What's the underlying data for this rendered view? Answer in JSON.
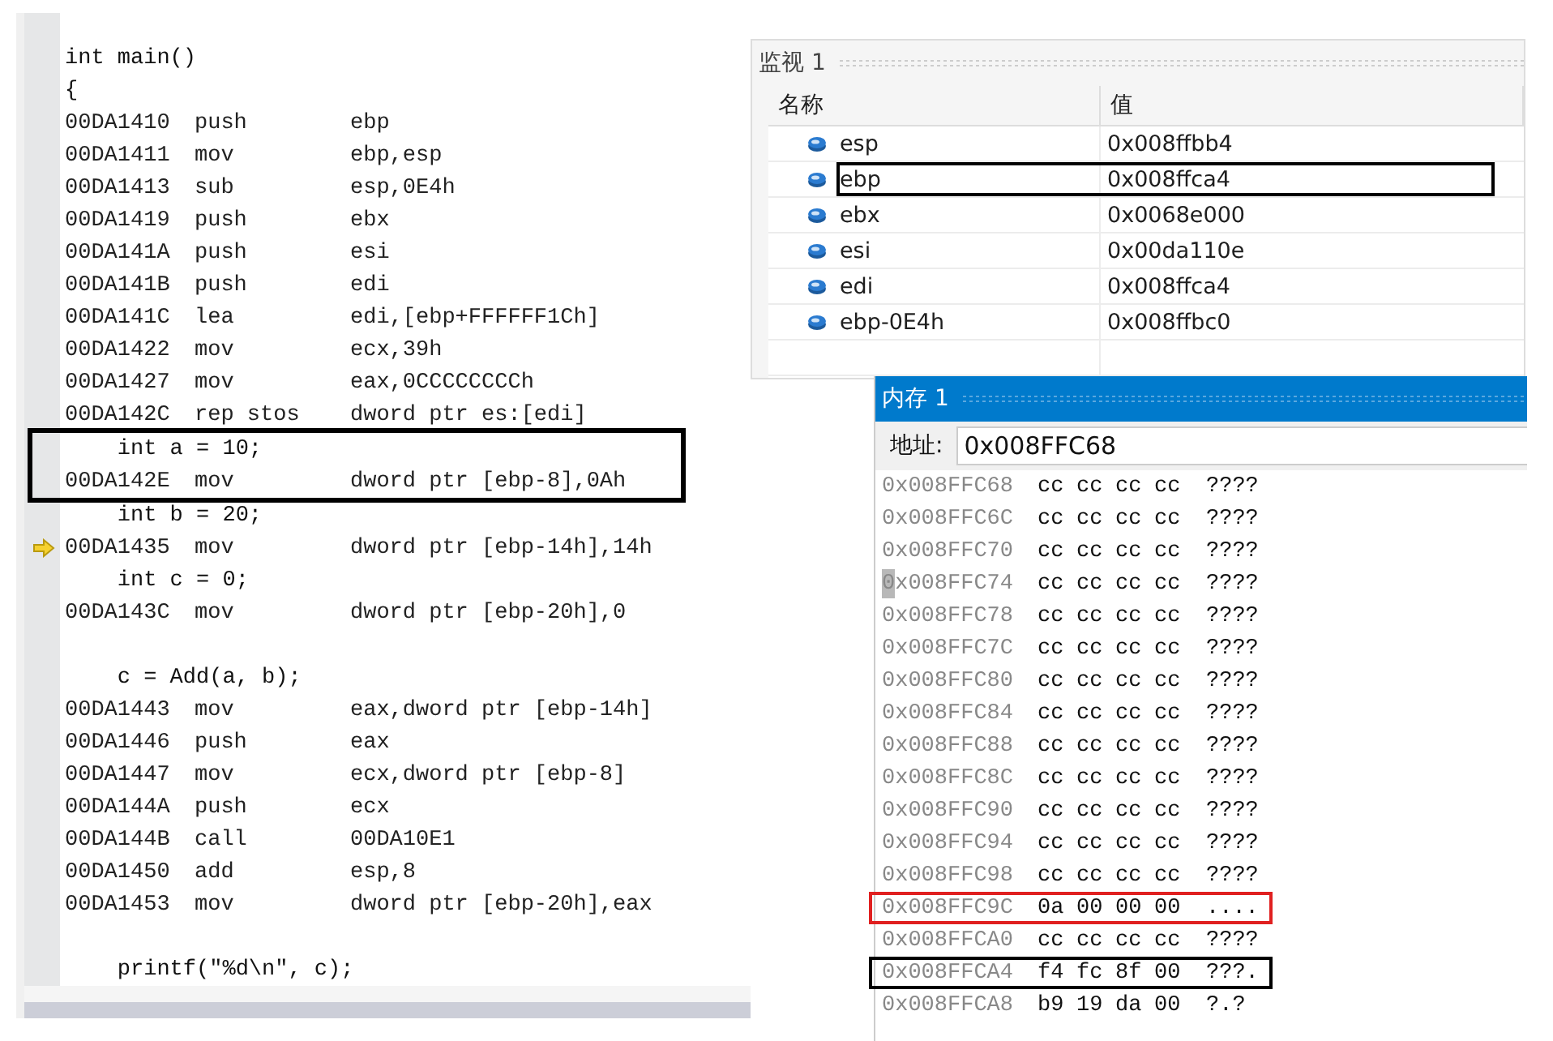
{
  "disassembly": {
    "lines": [
      {
        "kind": "source",
        "text": "int main()"
      },
      {
        "kind": "source",
        "text": "{"
      },
      {
        "kind": "asm",
        "address": "00DA1410",
        "mnemonic": "push",
        "operands": "ebp",
        "current": false
      },
      {
        "kind": "asm",
        "address": "00DA1411",
        "mnemonic": "mov",
        "operands": "ebp,esp",
        "current": false
      },
      {
        "kind": "asm",
        "address": "00DA1413",
        "mnemonic": "sub",
        "operands": "esp,0E4h",
        "current": false
      },
      {
        "kind": "asm",
        "address": "00DA1419",
        "mnemonic": "push",
        "operands": "ebx",
        "current": false
      },
      {
        "kind": "asm",
        "address": "00DA141A",
        "mnemonic": "push",
        "operands": "esi",
        "current": false
      },
      {
        "kind": "asm",
        "address": "00DA141B",
        "mnemonic": "push",
        "operands": "edi",
        "current": false
      },
      {
        "kind": "asm",
        "address": "00DA141C",
        "mnemonic": "lea",
        "operands": "edi,[ebp+FFFFFF1Ch]",
        "current": false
      },
      {
        "kind": "asm",
        "address": "00DA1422",
        "mnemonic": "mov",
        "operands": "ecx,39h",
        "current": false
      },
      {
        "kind": "asm",
        "address": "00DA1427",
        "mnemonic": "mov",
        "operands": "eax,0CCCCCCCCh",
        "current": false
      },
      {
        "kind": "asm",
        "address": "00DA142C",
        "mnemonic": "rep stos",
        "operands": "dword ptr es:[edi]",
        "current": false
      },
      {
        "kind": "outlined",
        "color": "#000000",
        "children": [
          {
            "kind": "source",
            "text": "    int a = 10;"
          },
          {
            "kind": "asm",
            "address": "00DA142E",
            "mnemonic": "mov",
            "operands": "dword ptr [ebp-8],0Ah",
            "current": false
          }
        ]
      },
      {
        "kind": "source",
        "text": "    int b = 20;"
      },
      {
        "kind": "asm",
        "address": "00DA1435",
        "mnemonic": "mov",
        "operands": "dword ptr [ebp-14h],14h",
        "current": true
      },
      {
        "kind": "source",
        "text": "    int c = 0;"
      },
      {
        "kind": "asm",
        "address": "00DA143C",
        "mnemonic": "mov",
        "operands": "dword ptr [ebp-20h],0",
        "current": false
      },
      {
        "kind": "blank"
      },
      {
        "kind": "source",
        "text": "    c = Add(a, b);"
      },
      {
        "kind": "asm",
        "address": "00DA1443",
        "mnemonic": "mov",
        "operands": "eax,dword ptr [ebp-14h]",
        "current": false
      },
      {
        "kind": "asm",
        "address": "00DA1446",
        "mnemonic": "push",
        "operands": "eax",
        "current": false
      },
      {
        "kind": "asm",
        "address": "00DA1447",
        "mnemonic": "mov",
        "operands": "ecx,dword ptr [ebp-8]",
        "current": false
      },
      {
        "kind": "asm",
        "address": "00DA144A",
        "mnemonic": "push",
        "operands": "ecx",
        "current": false
      },
      {
        "kind": "asm",
        "address": "00DA144B",
        "mnemonic": "call",
        "operands": "00DA10E1",
        "current": false
      },
      {
        "kind": "asm",
        "address": "00DA1450",
        "mnemonic": "add",
        "operands": "esp,8",
        "current": false
      },
      {
        "kind": "asm",
        "address": "00DA1453",
        "mnemonic": "mov",
        "operands": "dword ptr [ebp-20h],eax",
        "current": false
      },
      {
        "kind": "blank"
      },
      {
        "kind": "source",
        "text": "    printf(\"%d\\n\", c);"
      }
    ]
  },
  "watch": {
    "title": "监视 1",
    "columns": [
      "名称",
      "值"
    ],
    "rows": [
      {
        "name": "esp",
        "value": "0x008ffbb4",
        "outlined": false
      },
      {
        "name": "ebp",
        "value": "0x008ffca4",
        "outlined": true,
        "color": "#000000"
      },
      {
        "name": "ebx",
        "value": "0x0068e000",
        "outlined": false
      },
      {
        "name": "esi",
        "value": "0x00da110e",
        "outlined": false
      },
      {
        "name": "edi",
        "value": "0x008ffca4",
        "outlined": false
      },
      {
        "name": "ebp-0E4h",
        "value": "0x008ffbc0",
        "outlined": false
      }
    ]
  },
  "memory": {
    "title": "内存 1",
    "address_label": "地址:",
    "address_value": "0x008FFC68",
    "rows": [
      {
        "address": "0x008FFC68",
        "bytes": [
          "cc",
          "cc",
          "cc",
          "cc"
        ],
        "ascii": "????",
        "cursor": false,
        "outlined": false
      },
      {
        "address": "0x008FFC6C",
        "bytes": [
          "cc",
          "cc",
          "cc",
          "cc"
        ],
        "ascii": "????",
        "cursor": false,
        "outlined": false
      },
      {
        "address": "0x008FFC70",
        "bytes": [
          "cc",
          "cc",
          "cc",
          "cc"
        ],
        "ascii": "????",
        "cursor": false,
        "outlined": false
      },
      {
        "address": "0x008FFC74",
        "bytes": [
          "cc",
          "cc",
          "cc",
          "cc"
        ],
        "ascii": "????",
        "cursor": true,
        "outlined": false
      },
      {
        "address": "0x008FFC78",
        "bytes": [
          "cc",
          "cc",
          "cc",
          "cc"
        ],
        "ascii": "????",
        "cursor": false,
        "outlined": false
      },
      {
        "address": "0x008FFC7C",
        "bytes": [
          "cc",
          "cc",
          "cc",
          "cc"
        ],
        "ascii": "????",
        "cursor": false,
        "outlined": false
      },
      {
        "address": "0x008FFC80",
        "bytes": [
          "cc",
          "cc",
          "cc",
          "cc"
        ],
        "ascii": "????",
        "cursor": false,
        "outlined": false
      },
      {
        "address": "0x008FFC84",
        "bytes": [
          "cc",
          "cc",
          "cc",
          "cc"
        ],
        "ascii": "????",
        "cursor": false,
        "outlined": false
      },
      {
        "address": "0x008FFC88",
        "bytes": [
          "cc",
          "cc",
          "cc",
          "cc"
        ],
        "ascii": "????",
        "cursor": false,
        "outlined": false
      },
      {
        "address": "0x008FFC8C",
        "bytes": [
          "cc",
          "cc",
          "cc",
          "cc"
        ],
        "ascii": "????",
        "cursor": false,
        "outlined": false
      },
      {
        "address": "0x008FFC90",
        "bytes": [
          "cc",
          "cc",
          "cc",
          "cc"
        ],
        "ascii": "????",
        "cursor": false,
        "outlined": false
      },
      {
        "address": "0x008FFC94",
        "bytes": [
          "cc",
          "cc",
          "cc",
          "cc"
        ],
        "ascii": "????",
        "cursor": false,
        "outlined": false
      },
      {
        "address": "0x008FFC98",
        "bytes": [
          "cc",
          "cc",
          "cc",
          "cc"
        ],
        "ascii": "????",
        "cursor": false,
        "outlined": false
      },
      {
        "address": "0x008FFC9C",
        "bytes": [
          "0a",
          "00",
          "00",
          "00"
        ],
        "ascii": "....",
        "cursor": false,
        "outlined": true,
        "color": "#e02020"
      },
      {
        "address": "0x008FFCA0",
        "bytes": [
          "cc",
          "cc",
          "cc",
          "cc"
        ],
        "ascii": "????",
        "cursor": false,
        "outlined": false
      },
      {
        "address": "0x008FFCA4",
        "bytes": [
          "f4",
          "fc",
          "8f",
          "00"
        ],
        "ascii": "???.",
        "cursor": false,
        "outlined": true,
        "color": "#000000"
      },
      {
        "address": "0x008FFCA8",
        "bytes": [
          "b9",
          "19",
          "da",
          "00"
        ],
        "ascii": "?.?",
        "cursor": false,
        "outlined": false
      }
    ]
  }
}
